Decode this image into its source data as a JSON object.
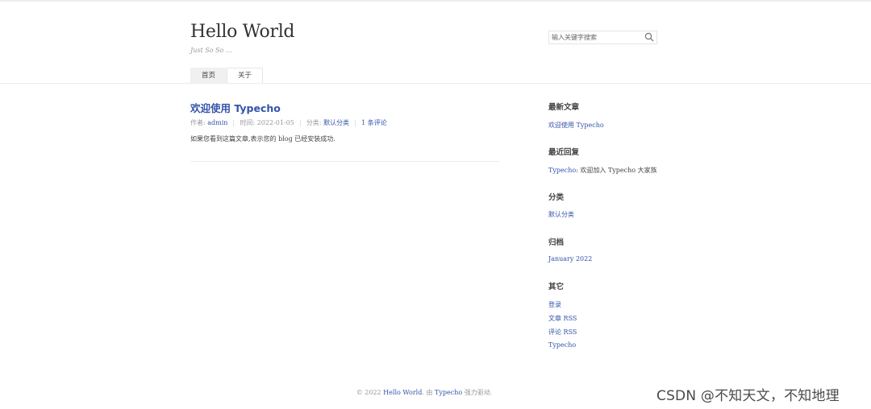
{
  "site": {
    "title": "Hello World",
    "description": "Just So So ..."
  },
  "search": {
    "placeholder": "输入关键字搜索"
  },
  "nav": {
    "items": [
      {
        "label": "首页",
        "active": true
      },
      {
        "label": "关于",
        "active": false
      }
    ]
  },
  "post": {
    "title": "欢迎使用 Typecho",
    "meta": {
      "author_label": "作者:",
      "author": "admin",
      "time_label": "时间:",
      "time": "2022-01-05",
      "category_label": "分类:",
      "category": "默认分类",
      "comments": "1 条评论"
    },
    "content": "如果您看到这篇文章,表示您的 blog 已经安装成功."
  },
  "sidebar": {
    "recent_posts": {
      "title": "最新文章",
      "items": [
        "欢迎使用 Typecho"
      ]
    },
    "recent_comments": {
      "title": "最近回复",
      "author": "Typecho",
      "text": ": 欢迎加入 Typecho 大家族"
    },
    "categories": {
      "title": "分类",
      "items": [
        "默认分类"
      ]
    },
    "archives": {
      "title": "归档",
      "items": [
        "January 2022"
      ]
    },
    "other": {
      "title": "其它",
      "items": [
        "登录",
        "文章 RSS",
        "评论 RSS",
        "Typecho"
      ]
    }
  },
  "footer": {
    "copyright": "© 2022 ",
    "site_link": "Hello World",
    "middle": ". 由 ",
    "powered_link": "Typecho",
    "suffix": " 强力驱动."
  },
  "watermark": "CSDN @不知天文，不知地理",
  "colors": {
    "link": "#3354aa",
    "text": "#444444",
    "muted": "#999999"
  }
}
